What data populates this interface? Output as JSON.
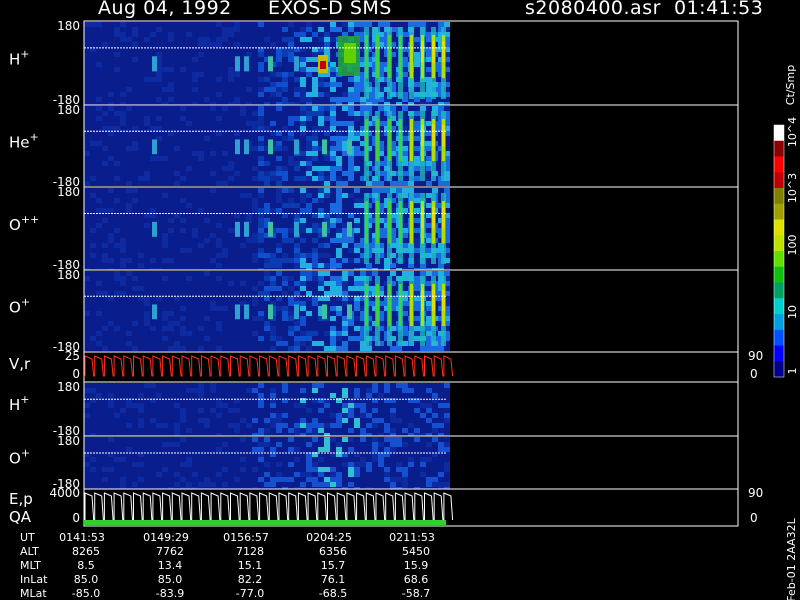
{
  "header": {
    "date": "Aug 04, 1992",
    "instrument": "EXOS-D SMS",
    "file_time": "s2080400.asr  01:41:53"
  },
  "colorbar": {
    "title": "Ct/Smp",
    "tick_labels": [
      "1",
      "10",
      "100",
      "10^3",
      "10^4"
    ],
    "colors": [
      "#00008b",
      "#0000ff",
      "#0050ff",
      "#00a0e0",
      "#00d0d0",
      "#00a060",
      "#10c010",
      "#60e000",
      "#c0e000",
      "#e0e000",
      "#a0a000",
      "#808000",
      "#c00000",
      "#ff0000",
      "#8b0000",
      "#ffffff"
    ]
  },
  "chart_data": [
    {
      "type": "heatmap",
      "ylabel": "H+",
      "ylabel_base": "H",
      "ylabel_sup": "+",
      "ylim": [
        -180,
        180
      ],
      "tick_labels": [
        "180",
        "-180"
      ]
    },
    {
      "type": "heatmap",
      "ylabel": "He+",
      "ylabel_base": "He",
      "ylabel_sup": "+",
      "ylim": [
        -180,
        180
      ],
      "tick_labels": [
        "180",
        "-180"
      ]
    },
    {
      "type": "heatmap",
      "ylabel": "O++",
      "ylabel_base": "O",
      "ylabel_sup": "++",
      "ylim": [
        -180,
        180
      ],
      "tick_labels": [
        "180",
        "-180"
      ]
    },
    {
      "type": "heatmap",
      "ylabel": "O+",
      "ylabel_base": "O",
      "ylabel_sup": "+",
      "ylim": [
        -180,
        180
      ],
      "tick_labels": [
        "180",
        "-180"
      ]
    },
    {
      "type": "line",
      "ylabel": "V,r",
      "left_ticks": [
        "25",
        "0"
      ],
      "right_ticks": [
        "90",
        "0"
      ]
    },
    {
      "type": "heatmap",
      "ylabel": "H+",
      "ylabel_base": "H",
      "ylabel_sup": "+",
      "ylim": [
        -180,
        180
      ],
      "tick_labels": [
        "180",
        "-180"
      ]
    },
    {
      "type": "heatmap",
      "ylabel": "O+",
      "ylabel_base": "O",
      "ylabel_sup": "+",
      "ylim": [
        -180,
        180
      ],
      "tick_labels": [
        "180",
        "-180"
      ]
    },
    {
      "type": "line",
      "ylabel": "E,p",
      "ylabel2": "QA",
      "left_ticks": [
        "4000",
        "0"
      ],
      "right_ticks": [
        "90",
        "0"
      ]
    }
  ],
  "ephemeris": {
    "labels": [
      "UT",
      "ALT",
      "MLT",
      "InLat",
      "MLat"
    ],
    "columns": [
      [
        "0141:53",
        "8265",
        "8.5",
        "85.0",
        "-85.0"
      ],
      [
        "0149:29",
        "7762",
        "13.4",
        "85.0",
        "-83.9"
      ],
      [
        "0156:57",
        "7128",
        "15.1",
        "82.2",
        "-77.0"
      ],
      [
        "0204:25",
        "6356",
        "15.7",
        "76.1",
        "-68.5"
      ],
      [
        "0211:53",
        "5450",
        "15.9",
        "68.6",
        "-58.7"
      ]
    ]
  },
  "footer_id": "Feb-01 2AA32L"
}
